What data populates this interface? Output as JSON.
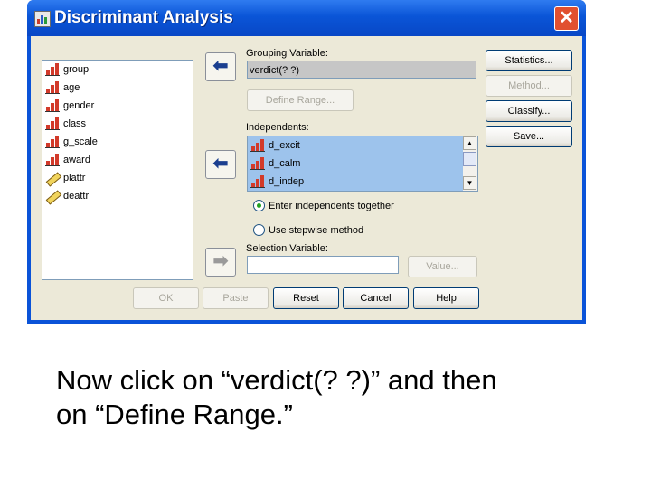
{
  "window": {
    "title": "Discriminant Analysis",
    "close_glyph": "✕",
    "app_icon": "bar-chart-icon"
  },
  "variables": [
    {
      "label": "group",
      "icon": "scale-variable-icon"
    },
    {
      "label": "age",
      "icon": "scale-variable-icon"
    },
    {
      "label": "gender",
      "icon": "scale-variable-icon"
    },
    {
      "label": "class",
      "icon": "scale-variable-icon"
    },
    {
      "label": "g_scale",
      "icon": "scale-variable-icon"
    },
    {
      "label": "award",
      "icon": "scale-variable-icon"
    },
    {
      "label": "plattr",
      "icon": "string-variable-icon"
    },
    {
      "label": "deattr",
      "icon": "string-variable-icon"
    }
  ],
  "grouping": {
    "label": "Grouping Variable:",
    "value": "verdict(? ?)",
    "define_range": "Define Range..."
  },
  "independents": {
    "label": "Independents:",
    "items": [
      "d_excit",
      "d_calm",
      "d_indep"
    ]
  },
  "method_options": {
    "together": "Enter independents together",
    "stepwise": "Use stepwise method",
    "selected": "together"
  },
  "selection": {
    "label": "Selection Variable:",
    "value": "",
    "value_button": "Value..."
  },
  "side_buttons": {
    "statistics": "Statistics...",
    "method": "Method...",
    "classify": "Classify...",
    "save": "Save..."
  },
  "bottom_buttons": {
    "ok": "OK",
    "paste": "Paste",
    "reset": "Reset",
    "cancel": "Cancel",
    "help": "Help"
  },
  "arrows": {
    "move_glyph": "⬅",
    "move_right_glyph": "➡"
  },
  "caption": {
    "line1": "Now click on “verdict(? ?)” and then",
    "line2": "on “Define Range.”"
  },
  "colors": {
    "title_bar": "#0a55d7",
    "dialog_bg": "#ece9d8",
    "selected_list": "#9dc3ec",
    "close_button": "#e1502f"
  }
}
